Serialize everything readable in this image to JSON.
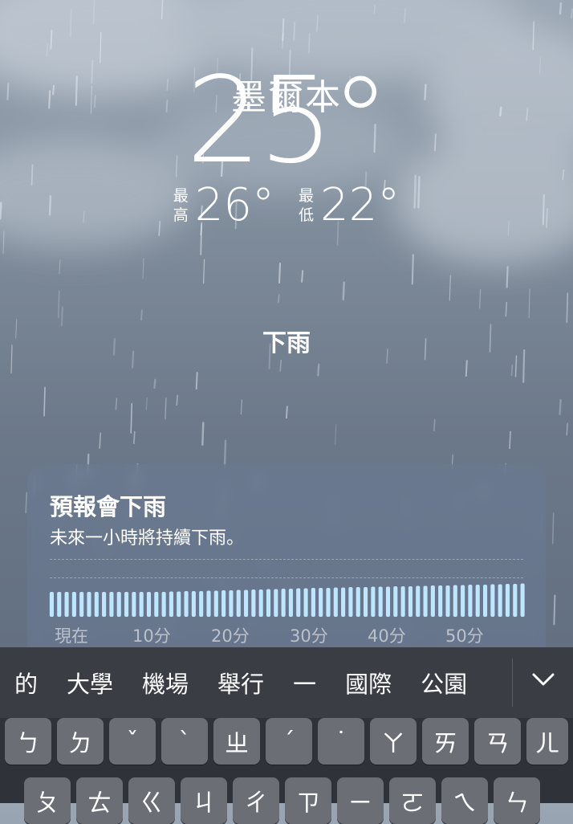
{
  "weather": {
    "city": "墨爾本",
    "temperature": "25°",
    "high_label_1": "最",
    "high_label_2": "高",
    "high": "26°",
    "low_label_1": "最",
    "low_label_2": "低",
    "low": "22°",
    "condition": "下雨"
  },
  "forecast_card": {
    "title": "預報會下雨",
    "subtitle": "未來一小時將持續下雨。",
    "ticks": [
      "現在",
      "10分",
      "20分",
      "30分",
      "40分",
      "50分"
    ],
    "intensity": [
      0.62,
      0.62,
      0.62,
      0.62,
      0.62,
      0.62,
      0.62,
      0.62,
      0.62,
      0.62,
      0.62,
      0.62,
      0.62,
      0.62,
      0.62,
      0.62,
      0.63,
      0.63,
      0.64,
      0.64,
      0.64,
      0.65,
      0.65,
      0.66,
      0.66,
      0.67,
      0.67,
      0.68,
      0.68,
      0.69,
      0.69,
      0.7,
      0.7,
      0.71,
      0.71,
      0.72,
      0.72,
      0.72,
      0.73,
      0.73,
      0.74,
      0.74,
      0.74,
      0.75,
      0.75,
      0.75,
      0.76,
      0.76,
      0.76,
      0.77,
      0.77,
      0.78,
      0.78,
      0.78,
      0.79,
      0.79,
      0.8,
      0.8,
      0.8,
      0.81,
      0.81,
      0.82,
      0.82,
      0.83
    ],
    "bar_color": "#bfe6ff"
  },
  "candidates": {
    "items": [
      "的",
      "大學",
      "機場",
      "舉行",
      "一",
      "國際",
      "公園"
    ],
    "expand_icon": "chevron-down-icon"
  },
  "keyboard": {
    "row1": [
      "ㄅ",
      "ㄉ",
      "ˇ",
      "ˋ",
      "ㄓ",
      "ˊ",
      "˙",
      "ㄚ",
      "ㄞ",
      "ㄢ",
      "ㄦ"
    ],
    "row2": [
      "ㄆ",
      "ㄊ",
      "ㄍ",
      "ㄐ",
      "ㄔ",
      "ㄗ",
      "ㄧ",
      "ㄛ",
      "ㄟ",
      "ㄣ"
    ]
  }
}
